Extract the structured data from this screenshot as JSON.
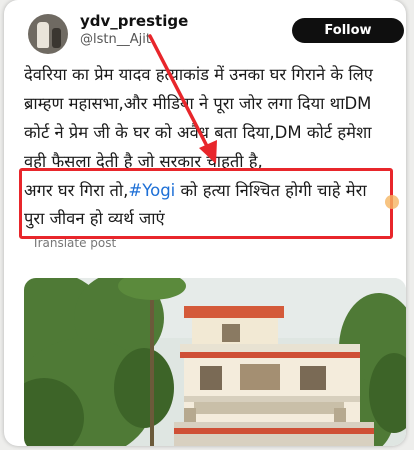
{
  "tweet": {
    "display_name": "ydv_prestige",
    "handle": "@lstn__Ajit",
    "follow_label": "Follow",
    "lines": [
      "देवरिया का प्रेम यादव हत्याकांड में उनका घर गिराने के लिए",
      "ब्राम्हण महासभा,और मीडिया ने पूरा जोर लगा दिया थाDM",
      "कोर्ट ने प्रेम जी के घर को अवैध बता दिया,DM कोर्ट हमेशा",
      "वही फैसला देती है जो सरकार चाहती है,"
    ],
    "highlight_pre": "अगर घर गिरा तो,",
    "hashtag": "#Yogi",
    "highlight_post": " को हत्या निश्चित होगी चाहे मेरा",
    "highlight_line2": "पुरा जीवन हो व्यर्थ जाएं",
    "translate_label": "Translate post"
  },
  "colors": {
    "hashtag": "#1d6fd6",
    "annotation_red": "#e8262b",
    "follow_bg": "#0f0f0f"
  },
  "icons": {
    "avatar": "profile-photo",
    "arrow": "red-arrow-annotation"
  },
  "media": {
    "type": "photo",
    "subject": "two-story house with balcony among trees"
  }
}
